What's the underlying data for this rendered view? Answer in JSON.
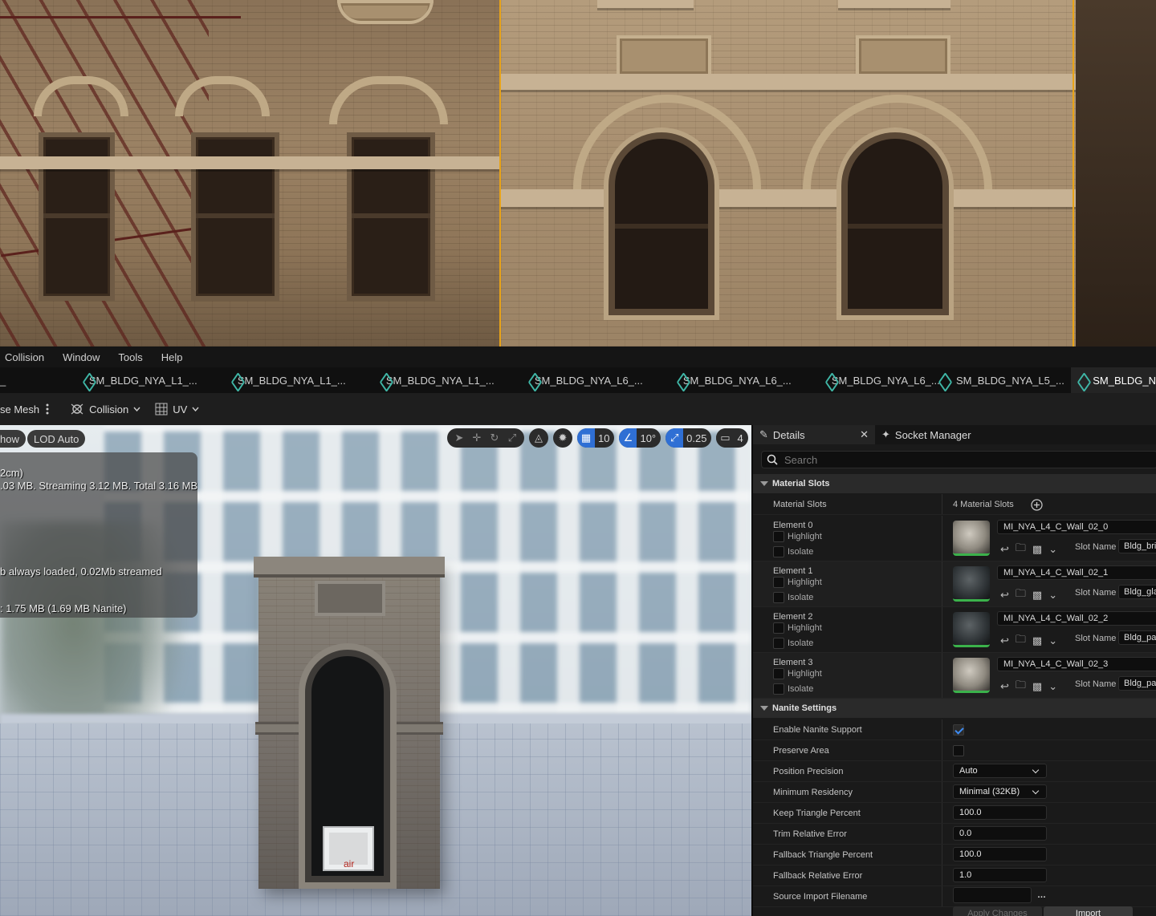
{
  "menu": {
    "items": [
      "Collision",
      "Window",
      "Tools",
      "Help"
    ]
  },
  "asset_tabs": [
    {
      "label": "_"
    },
    {
      "label": "SM_BLDG_NYA_L1_..."
    },
    {
      "label": "SM_BLDG_NYA_L1_..."
    },
    {
      "label": "SM_BLDG_NYA_L1_..."
    },
    {
      "label": "SM_BLDG_NYA_L6_..."
    },
    {
      "label": "SM_BLDG_NYA_L6_..."
    },
    {
      "label": "SM_BLDG_NYA_L6_..."
    },
    {
      "label": "SM_BLDG_NYA_L5_..."
    },
    {
      "label": "SM_BLDG_N",
      "active": true
    }
  ],
  "toolbar": {
    "base_mesh": "se Mesh",
    "collision": "Collision",
    "uv": "UV"
  },
  "viewport": {
    "show_label": "how",
    "lod_label": "LOD Auto",
    "stats": [
      "2cm)",
      ".03 MB. Streaming 3.12 MB. Total 3.16 MB.",
      "b always loaded, 0.02Mb streamed",
      ": 1.75 MB (1.69 MB Nanite)"
    ],
    "grid_snap": "10",
    "rotation_snap": "10°",
    "scale_snap": "0.25",
    "camera_speed": "4",
    "ac_label": "air"
  },
  "details": {
    "tab_details": "Details",
    "tab_socket": "Socket Manager",
    "search_placeholder": "Search",
    "material_slots": {
      "header": "Material Slots",
      "row_label": "Material Slots",
      "count_label": "4 Material Slots",
      "elements": [
        {
          "title": "Element 0",
          "highlight": "Highlight",
          "isolate": "Isolate",
          "material": "MI_NYA_L4_C_Wall_02_0",
          "slot_label": "Slot Name",
          "slot_value": "Bldg_bric",
          "thumb": "light"
        },
        {
          "title": "Element 1",
          "highlight": "Highlight",
          "isolate": "Isolate",
          "material": "MI_NYA_L4_C_Wall_02_1",
          "slot_label": "Slot Name",
          "slot_value": "Bldg_glas",
          "thumb": "dark"
        },
        {
          "title": "Element 2",
          "highlight": "Highlight",
          "isolate": "Isolate",
          "material": "MI_NYA_L4_C_Wall_02_2",
          "slot_label": "Slot Name",
          "slot_value": "Bldg_pair",
          "thumb": "dark"
        },
        {
          "title": "Element 3",
          "highlight": "Highlight",
          "isolate": "Isolate",
          "material": "MI_NYA_L4_C_Wall_02_3",
          "slot_label": "Slot Name",
          "slot_value": "Bldg_pair",
          "thumb": "light"
        }
      ]
    },
    "nanite": {
      "header": "Nanite Settings",
      "enable_label": "Enable Nanite Support",
      "enable_value": true,
      "preserve_label": "Preserve Area",
      "preserve_value": false,
      "position_precision_label": "Position Precision",
      "position_precision_value": "Auto",
      "min_residency_label": "Minimum Residency",
      "min_residency_value": "Minimal (32KB)",
      "keep_triangle_label": "Keep Triangle Percent",
      "keep_triangle_value": "100.0",
      "trim_error_label": "Trim Relative Error",
      "trim_error_value": "0.0",
      "fallback_triangle_label": "Fallback Triangle Percent",
      "fallback_triangle_value": "100.0",
      "fallback_error_label": "Fallback Relative Error",
      "fallback_error_value": "1.0",
      "source_import_label": "Source Import Filename",
      "source_import_value": "",
      "apply_label": "Apply Changes",
      "import_label": "Import"
    }
  },
  "colors": {
    "accent": "#2f6fd4",
    "selection_outline": "#e8a318",
    "mesh_tab_icon": "#3fb6a6"
  }
}
